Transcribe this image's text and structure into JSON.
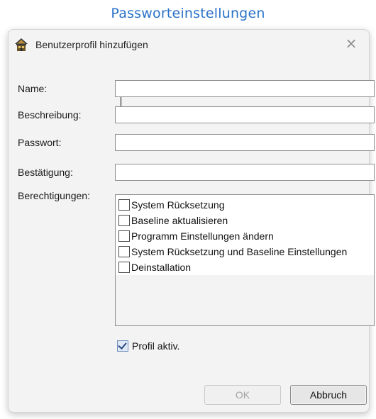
{
  "page_heading": "Passworteinstellungen",
  "dialog": {
    "title": "Benutzerprofil hinzufügen",
    "close_glyph": "×",
    "icon": "home-icon"
  },
  "form": {
    "name_label": "Name:",
    "name_value": "",
    "description_label": "Beschreibung:",
    "description_value": "",
    "password_label": "Passwort:",
    "password_value": "",
    "confirm_label": "Bestätigung:",
    "confirm_value": "",
    "permissions_label": "Berechtigungen:",
    "permissions": [
      {
        "label": "System Rücksetzung",
        "checked": false
      },
      {
        "label": "Baseline aktualisieren",
        "checked": false
      },
      {
        "label": "Programm Einstellungen ändern",
        "checked": false
      },
      {
        "label": "System Rücksetzung und Baseline Einstellungen",
        "checked": false
      },
      {
        "label": "Deinstallation",
        "checked": false
      }
    ],
    "profile_active_label": "Profil aktiv.",
    "profile_active_checked": true
  },
  "buttons": {
    "ok_label": "OK",
    "cancel_label": "Abbruch"
  },
  "colors": {
    "heading": "#2a72c8",
    "dialog_bg": "#f3f3f3"
  }
}
